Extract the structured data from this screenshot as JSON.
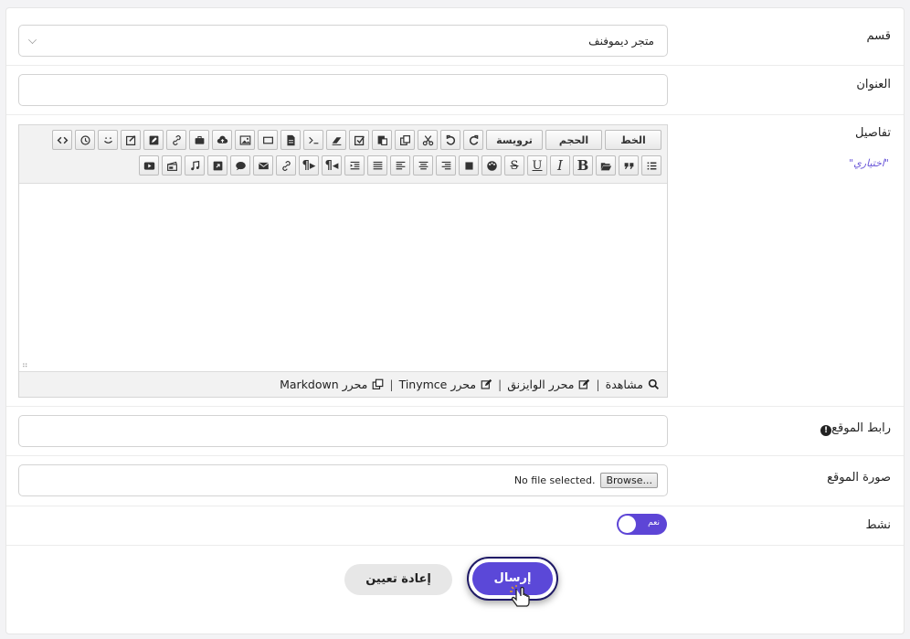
{
  "category": {
    "label": "قسم",
    "value": "متجر ديموفنف"
  },
  "title_field": {
    "label": "العنوان",
    "value": ""
  },
  "details": {
    "label": "تفاصيل",
    "optional": "\"اختياري\"",
    "toolbar": {
      "font": "الخط",
      "size": "الحجم",
      "heading": "ترويسة"
    },
    "status": {
      "preview": "مشاهدة",
      "wysiwyg": "محرر الوايزنق",
      "tinymce": "محرر Tinymce",
      "markdown": "محرر Markdown",
      "sep": "|"
    }
  },
  "website_url": {
    "label": "رابط الموقع",
    "warning_icon": "!",
    "value": ""
  },
  "website_image": {
    "label": "صورة الموقع",
    "browse": "Browse...",
    "no_file": "No file selected."
  },
  "active": {
    "label": "نشط",
    "toggle_text": "نعم",
    "on": true
  },
  "actions": {
    "submit": "إرسال",
    "reset": "إعادة تعيين"
  },
  "colors": {
    "accent": "#5b48d8",
    "optional_text": "#6a57d8"
  }
}
